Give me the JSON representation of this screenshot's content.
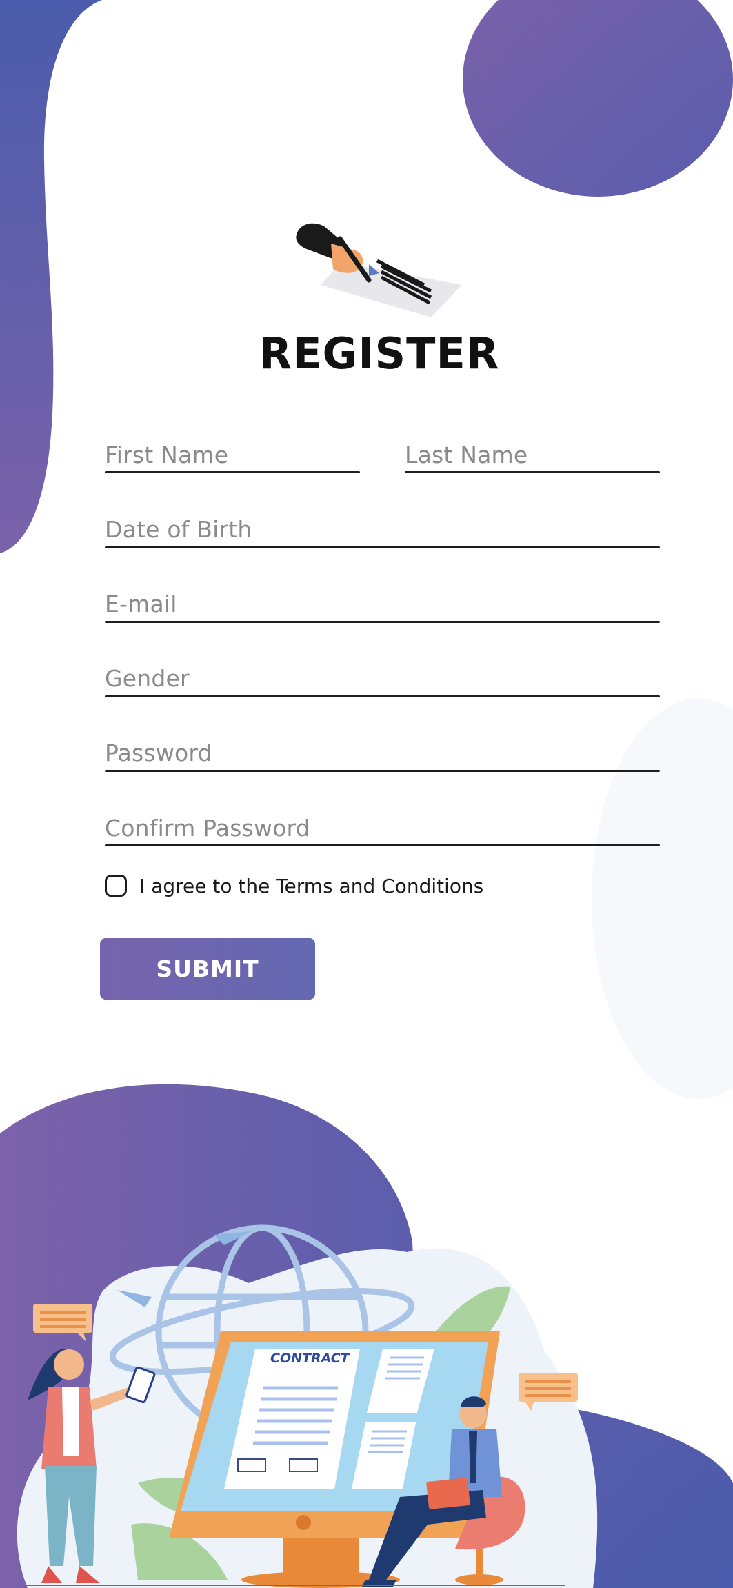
{
  "form": {
    "title": "REGISTER",
    "fields": {
      "first_name": "First Name",
      "last_name": "Last Name",
      "dob": "Date of Birth",
      "email": "E-mail",
      "gender": "Gender",
      "password": "Password",
      "confirm_password": "Confirm Password"
    },
    "terms_label": "I agree to the Terms and Conditions",
    "terms_checked": false,
    "submit_label": "SUBMIT"
  },
  "illustration": {
    "contract_label": "CONTRACT"
  },
  "colors": {
    "purple_start": "#7b62aa",
    "purple_end": "#4a5cab",
    "accent_orange": "#f2a255",
    "screen_blue": "#a7d8f2"
  },
  "icons": {
    "header": "signing-document-icon",
    "checkbox": "checkbox-icon"
  }
}
